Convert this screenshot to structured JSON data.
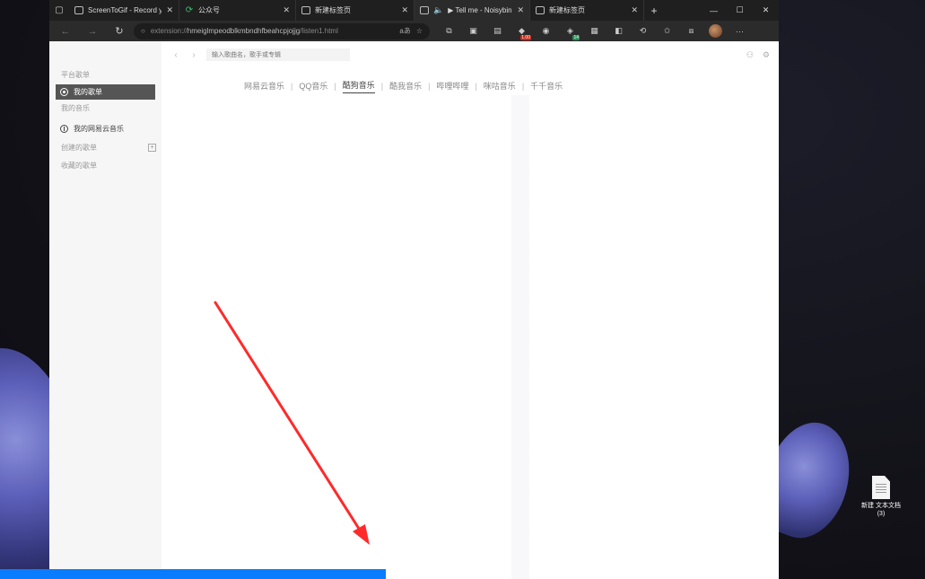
{
  "desktop": {
    "file_label": "新建 文本文档 (3)"
  },
  "browser": {
    "tabs": [
      {
        "title": "ScreenToGif - Record your",
        "icon": "monitor-icon",
        "active": false
      },
      {
        "title": "公众号",
        "icon": "wechat-green-icon",
        "active": false
      },
      {
        "title": "新建标签页",
        "icon": "page-icon",
        "active": false
      },
      {
        "title": "▶ Tell me - Noisybin",
        "icon": "page-icon",
        "active": true,
        "audio": true
      },
      {
        "title": "新建标签页",
        "icon": "page-icon",
        "active": false
      }
    ],
    "new_tab": "+",
    "window_controls": {
      "minimize": "—",
      "maximize": "☐",
      "close": "✕"
    },
    "address": {
      "scheme": "extension://",
      "host": "hmeiglmpeodblkmbndhfbeahcpjojjg",
      "path": "/listen1.html",
      "read_aloud": "aあ"
    },
    "extension_badges": {
      "ext1": "1.00",
      "ext2": "14"
    },
    "menu_more": "···"
  },
  "app": {
    "sidebar": {
      "platform_section": "平台歌单",
      "items": [
        {
          "label": "我的歌单"
        }
      ],
      "my_music_section": "我的音乐",
      "netease_item": "我的网易云音乐",
      "created_playlists": "创建的歌单",
      "favorite_playlists": "收藏的歌单"
    },
    "search": {
      "placeholder": "输入歌曲名，歌手或专辑"
    },
    "source_tabs": [
      {
        "label": "网易云音乐",
        "active": false
      },
      {
        "label": "QQ音乐",
        "active": false
      },
      {
        "label": "酷狗音乐",
        "active": true
      },
      {
        "label": "酷我音乐",
        "active": false
      },
      {
        "label": "哔哩哔哩",
        "active": false
      },
      {
        "label": "咪咕音乐",
        "active": false
      },
      {
        "label": "千千音乐",
        "active": false
      }
    ]
  },
  "colors": {
    "arrow": "#ff2a2a",
    "progress": "#0a7cff",
    "sidebar_active": "#555555"
  }
}
